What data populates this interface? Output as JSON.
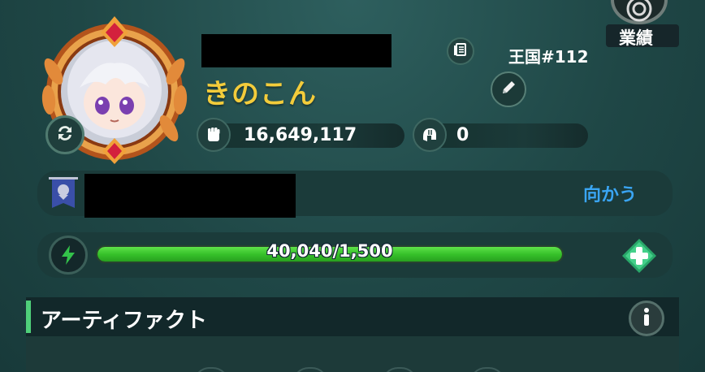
{
  "header": {
    "achievements_label": "業績",
    "achievements_icon": "medal-icon"
  },
  "profile": {
    "player_name": "きのこん",
    "kingdom_label": "王国#112",
    "power_value": "16,649,117",
    "power_icon": "fist-icon",
    "helmet_value": "0",
    "helmet_icon": "helmet-icon",
    "swap_icon": "swap-icon",
    "edit_icon": "pencil-icon",
    "book_icon": "book-icon"
  },
  "guild": {
    "goto_label": "向かう",
    "banner_icon": "guild-banner-icon"
  },
  "energy": {
    "text": "40,040/1,500",
    "fill_fraction": 1.0,
    "icon": "lightning-icon",
    "add_icon": "plus-icon"
  },
  "artifact": {
    "title": "アーティファクト",
    "info_icon": "info-icon"
  },
  "colors": {
    "name_gold": "#f3cc3b",
    "link_blue": "#3aa5f3",
    "energy_green": "#37c12a",
    "accent_green": "#4fd07a"
  }
}
